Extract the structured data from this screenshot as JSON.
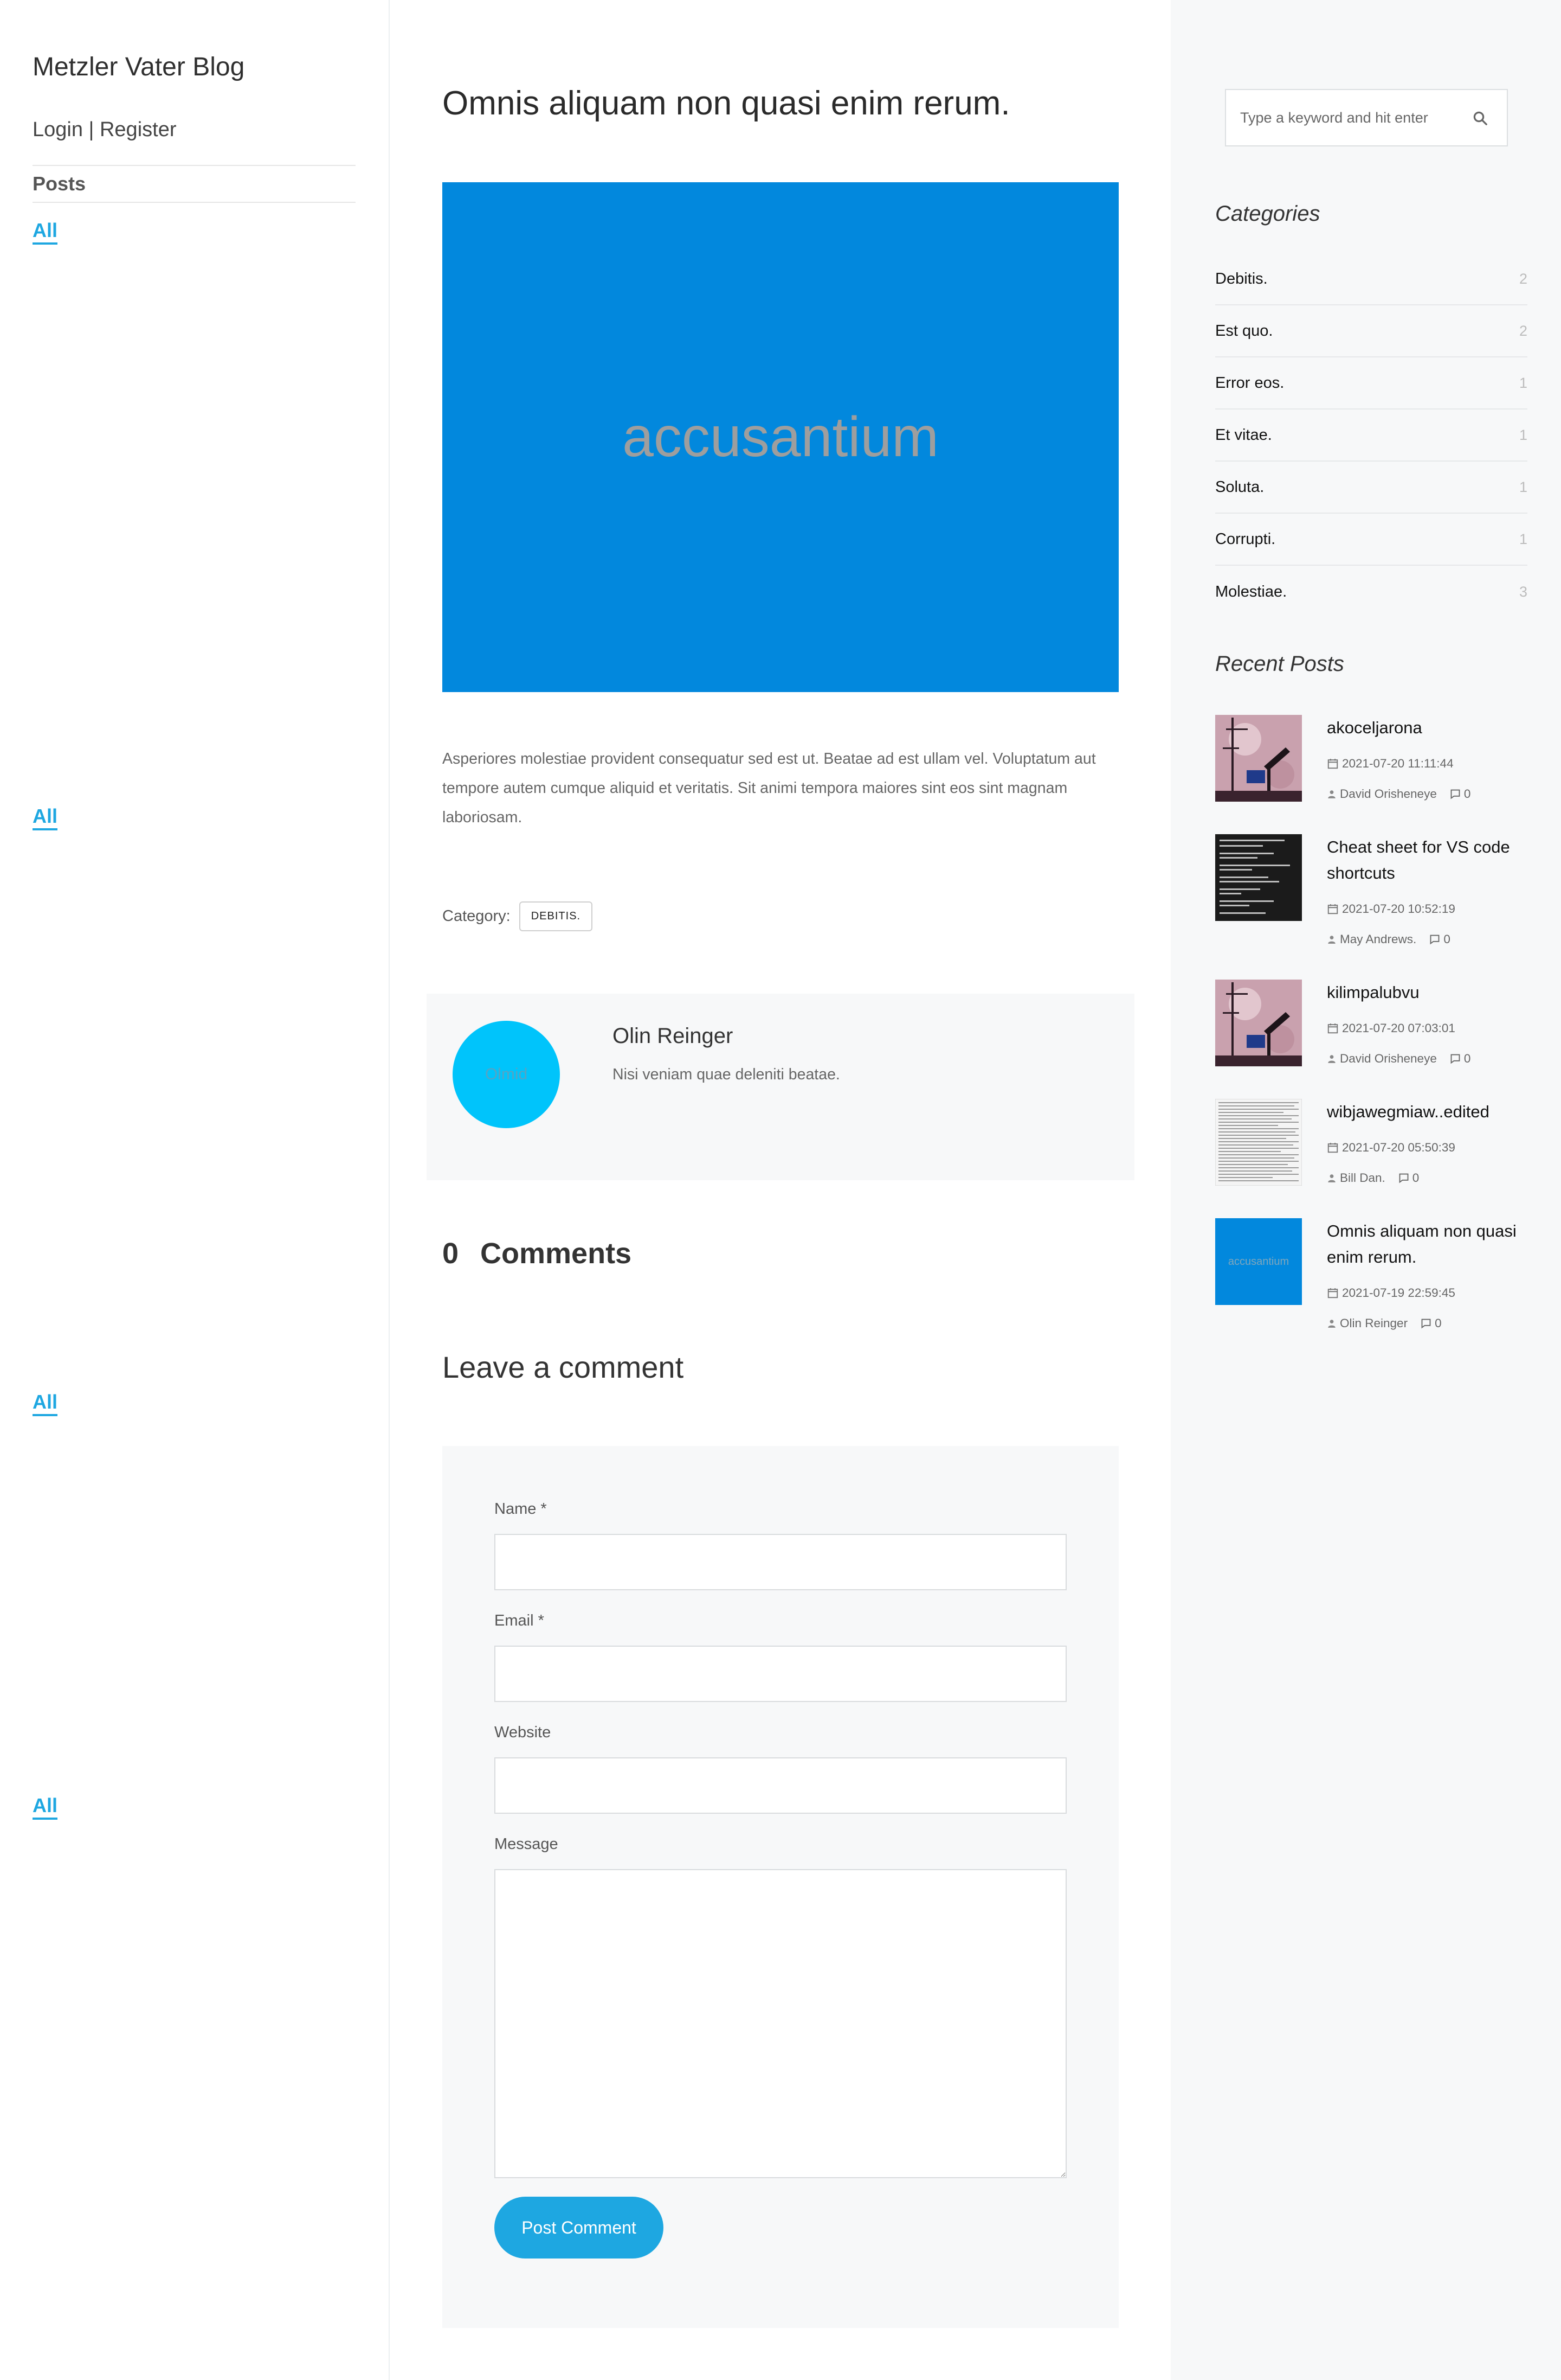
{
  "site": {
    "title": "Metzler Vater Blog",
    "login": "Login",
    "separator": "|",
    "register": "Register"
  },
  "nav": {
    "heading": "Posts",
    "links": [
      "All",
      "All",
      "All",
      "All"
    ]
  },
  "post": {
    "title": "Omnis aliquam non quasi enim rerum.",
    "hero_text": "accusantium",
    "hero_color": "#0288dd",
    "excerpt": "Asperiores molestiae provident consequatur sed est ut. Beatae ad est ullam vel. Voluptatum aut tempore autem cumque aliquid et veritatis. Sit animi tempora maiores sint eos sint magnam laboriosam.",
    "category_label": "Category:",
    "category_tag": "DEBITIS."
  },
  "author": {
    "avatar_text": "Olmid",
    "avatar_color": "#00c4fb",
    "name": "Olin Reinger",
    "bio": "Nisi veniam quae deleniti beatae."
  },
  "comments": {
    "count": "0",
    "label": "Comments"
  },
  "comment_form": {
    "heading": "Leave a comment",
    "name_label": "Name *",
    "email_label": "Email *",
    "website_label": "Website",
    "message_label": "Message",
    "submit_label": "Post Comment",
    "accent_color": "#1ea7e1"
  },
  "search": {
    "placeholder": "Type a keyword and hit enter",
    "icon": "search-icon"
  },
  "categories": {
    "heading": "Categories",
    "items": [
      {
        "name": "Debitis.",
        "count": "2"
      },
      {
        "name": "Est quo.",
        "count": "2"
      },
      {
        "name": "Error eos.",
        "count": "1"
      },
      {
        "name": "Et vitae.",
        "count": "1"
      },
      {
        "name": "Soluta.",
        "count": "1"
      },
      {
        "name": "Corrupti.",
        "count": "1"
      },
      {
        "name": "Molestiae.",
        "count": "3"
      }
    ]
  },
  "recent_posts": {
    "heading": "Recent Posts",
    "items": [
      {
        "title": "akoceljarona",
        "date": "2021-07-20 11:11:44",
        "author": "David Orisheneye",
        "comments": "0",
        "thumb": "telescope-photo"
      },
      {
        "title": "Cheat sheet for VS code shortcuts",
        "date": "2021-07-20 10:52:19",
        "author": "May Andrews.",
        "comments": "0",
        "thumb": "dark-text-screenshot"
      },
      {
        "title": "kilimpalubvu",
        "date": "2021-07-20 07:03:01",
        "author": "David Orisheneye",
        "comments": "0",
        "thumb": "telescope-photo"
      },
      {
        "title": "wibjawegmiaw..edited",
        "date": "2021-07-20 05:50:39",
        "author": "Bill Dan.",
        "comments": "0",
        "thumb": "document-scan"
      },
      {
        "title": "Omnis aliquam non quasi enim rerum.",
        "date": "2021-07-19 22:59:45",
        "author": "Olin Reinger",
        "comments": "0",
        "thumb": "accusantium",
        "thumb_text": "accusantium"
      }
    ]
  }
}
